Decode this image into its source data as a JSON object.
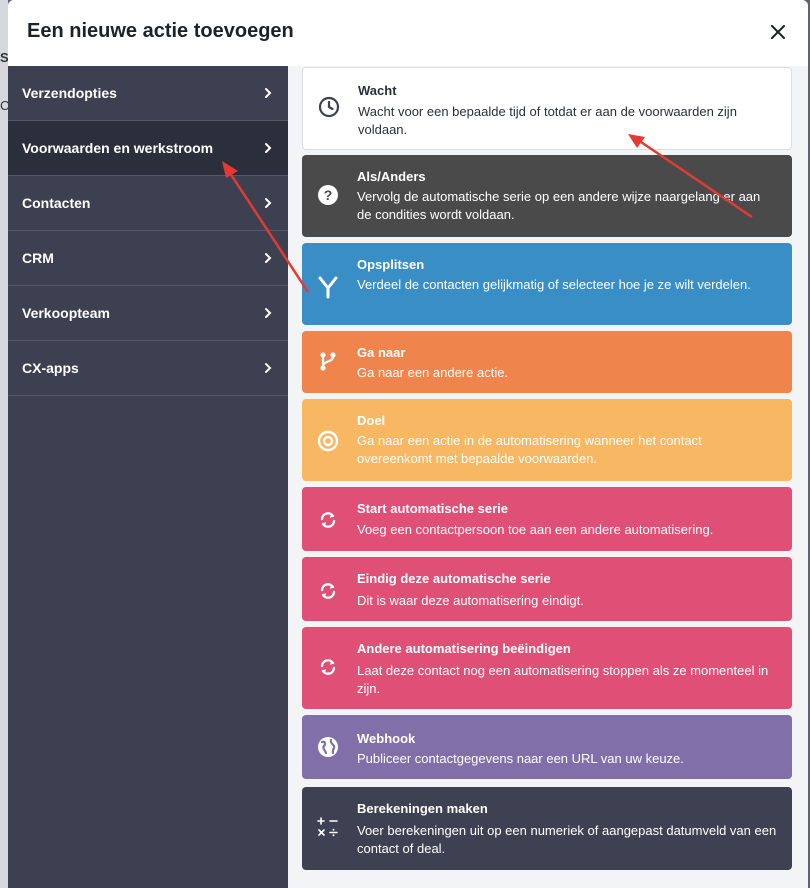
{
  "background": {
    "fragment_1": "S",
    "fragment_2": "C"
  },
  "modal": {
    "title": "Een nieuwe actie toevoegen"
  },
  "sidebar": {
    "items": [
      {
        "label": "Verzendopties"
      },
      {
        "label": "Voorwaarden en werkstroom"
      },
      {
        "label": "Contacten"
      },
      {
        "label": "CRM"
      },
      {
        "label": "Verkoopteam"
      },
      {
        "label": "CX-apps"
      }
    ],
    "active_index": 1
  },
  "actions": [
    {
      "title": "Wacht",
      "desc": "Wacht voor een bepaalde tijd of totdat er aan de voorwaarden zijn voldaan.",
      "icon": "clock-icon"
    },
    {
      "title": "Als/Anders",
      "desc": "Vervolg de automatische serie op een andere wijze naargelang er aan de condities wordt voldaan.",
      "icon": "question-icon"
    },
    {
      "title": "Opsplitsen",
      "desc": "Verdeel de contacten gelijkmatig of selecteer hoe je ze wilt verdelen.",
      "icon": "split-icon"
    },
    {
      "title": "Ga naar",
      "desc": "Ga naar een andere actie.",
      "icon": "branch-icon"
    },
    {
      "title": "Doel",
      "desc": "Ga naar een actie in de automatisering wanneer het contact overeenkomt met bepaalde voorwaarden.",
      "icon": "target-icon"
    },
    {
      "title": "Start automatische serie",
      "desc": "Voeg een contactpersoon toe aan een andere automatisering.",
      "icon": "sync-icon"
    },
    {
      "title": "Eindig deze automatische serie",
      "desc": "Dit is waar deze automatisering eindigt.",
      "icon": "sync-icon"
    },
    {
      "title": "Andere automatisering beëindigen",
      "desc": "Laat deze contact nog een automatisering stoppen als ze momenteel in zijn.",
      "icon": "sync-icon"
    },
    {
      "title": "Webhook",
      "desc": "Publiceer contactgegevens naar een URL van uw keuze.",
      "icon": "globe-icon"
    },
    {
      "title": "Berekeningen maken",
      "desc": "Voer berekeningen uit op een numeriek of aangepast datumveld van een contact of deal.",
      "icon": "calculator-icon"
    }
  ],
  "colors": {
    "sidebar_bg": "#3c4050",
    "sidebar_active": "#2b2f3c",
    "dark": "#4a4a4a",
    "blue": "#3a8ec6",
    "orange": "#ef844c",
    "yellow": "#f7b763",
    "pink": "#e04f76",
    "purple": "#806fa8",
    "slate": "#3d4151",
    "annotation_arrow": "#e53935"
  }
}
